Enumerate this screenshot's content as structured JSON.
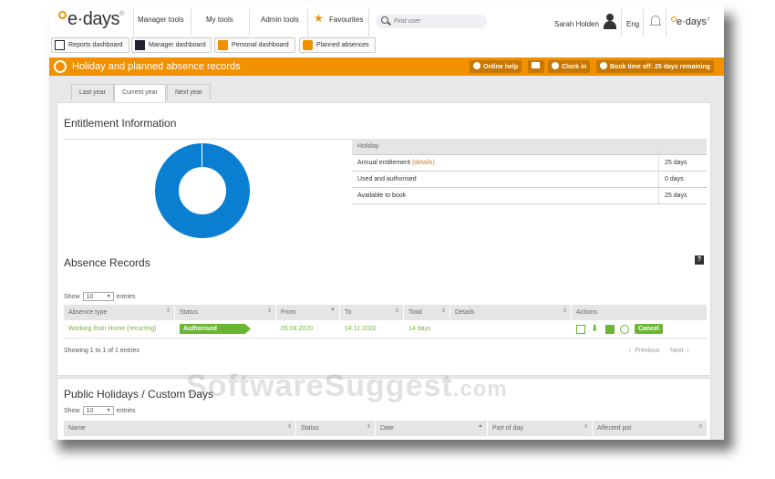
{
  "brand": {
    "name": "e·days",
    "small": "e·days"
  },
  "nav": {
    "manager_tools": "Manager tools",
    "my_tools": "My tools",
    "admin_tools": "Admin tools",
    "favourites": "Favourites",
    "search_placeholder": "Find user",
    "user_name": "Sarah Holden",
    "language": "Eng"
  },
  "dashboards": [
    "Reports dashboard",
    "Manager dashboard",
    "Personal dashboard",
    "Planned absences"
  ],
  "header": {
    "title": "Holiday and planned absence records",
    "online_help": "Online help",
    "clock_in": "Clock in",
    "book_time_off": "Book time off: 25 days remaining"
  },
  "tabs": [
    "Last year",
    "Current year",
    "Next year"
  ],
  "entitlement": {
    "title": "Entitlement Information",
    "table_header": "Holiday",
    "rows": [
      {
        "label": "Annual entitlement",
        "link": "(details)",
        "value": "25 days"
      },
      {
        "label": "Used and authorised",
        "link": "",
        "value": "0 days"
      },
      {
        "label": "Available to book",
        "link": "",
        "value": "25 days"
      }
    ],
    "chart_color": "#0a7fd1"
  },
  "absence": {
    "title": "Absence Records",
    "help": "?",
    "show_label": "Show",
    "show_value": "10",
    "entries_label": "entries",
    "columns": [
      "Absence type",
      "Status",
      "From",
      "To",
      "Total",
      "Details",
      "Actions"
    ],
    "row": {
      "type": "Working from Home (recurring)",
      "status": "Authorised",
      "from": "05.08.2020",
      "to": "04.11.2020",
      "total": "14 days",
      "details": "",
      "cancel": "Cancel"
    },
    "showing": "Showing 1 to 1 of 1 entries",
    "previous": "Previous",
    "next": "Next"
  },
  "public": {
    "title": "Public Holidays / Custom Days",
    "show_label": "Show",
    "show_value": "10",
    "entries_label": "entries",
    "columns": [
      "Name",
      "Status",
      "Date",
      "Part of day",
      "Affected pot"
    ]
  },
  "watermark": {
    "main": "SoftwareSuggest",
    "suffix": ".com"
  }
}
